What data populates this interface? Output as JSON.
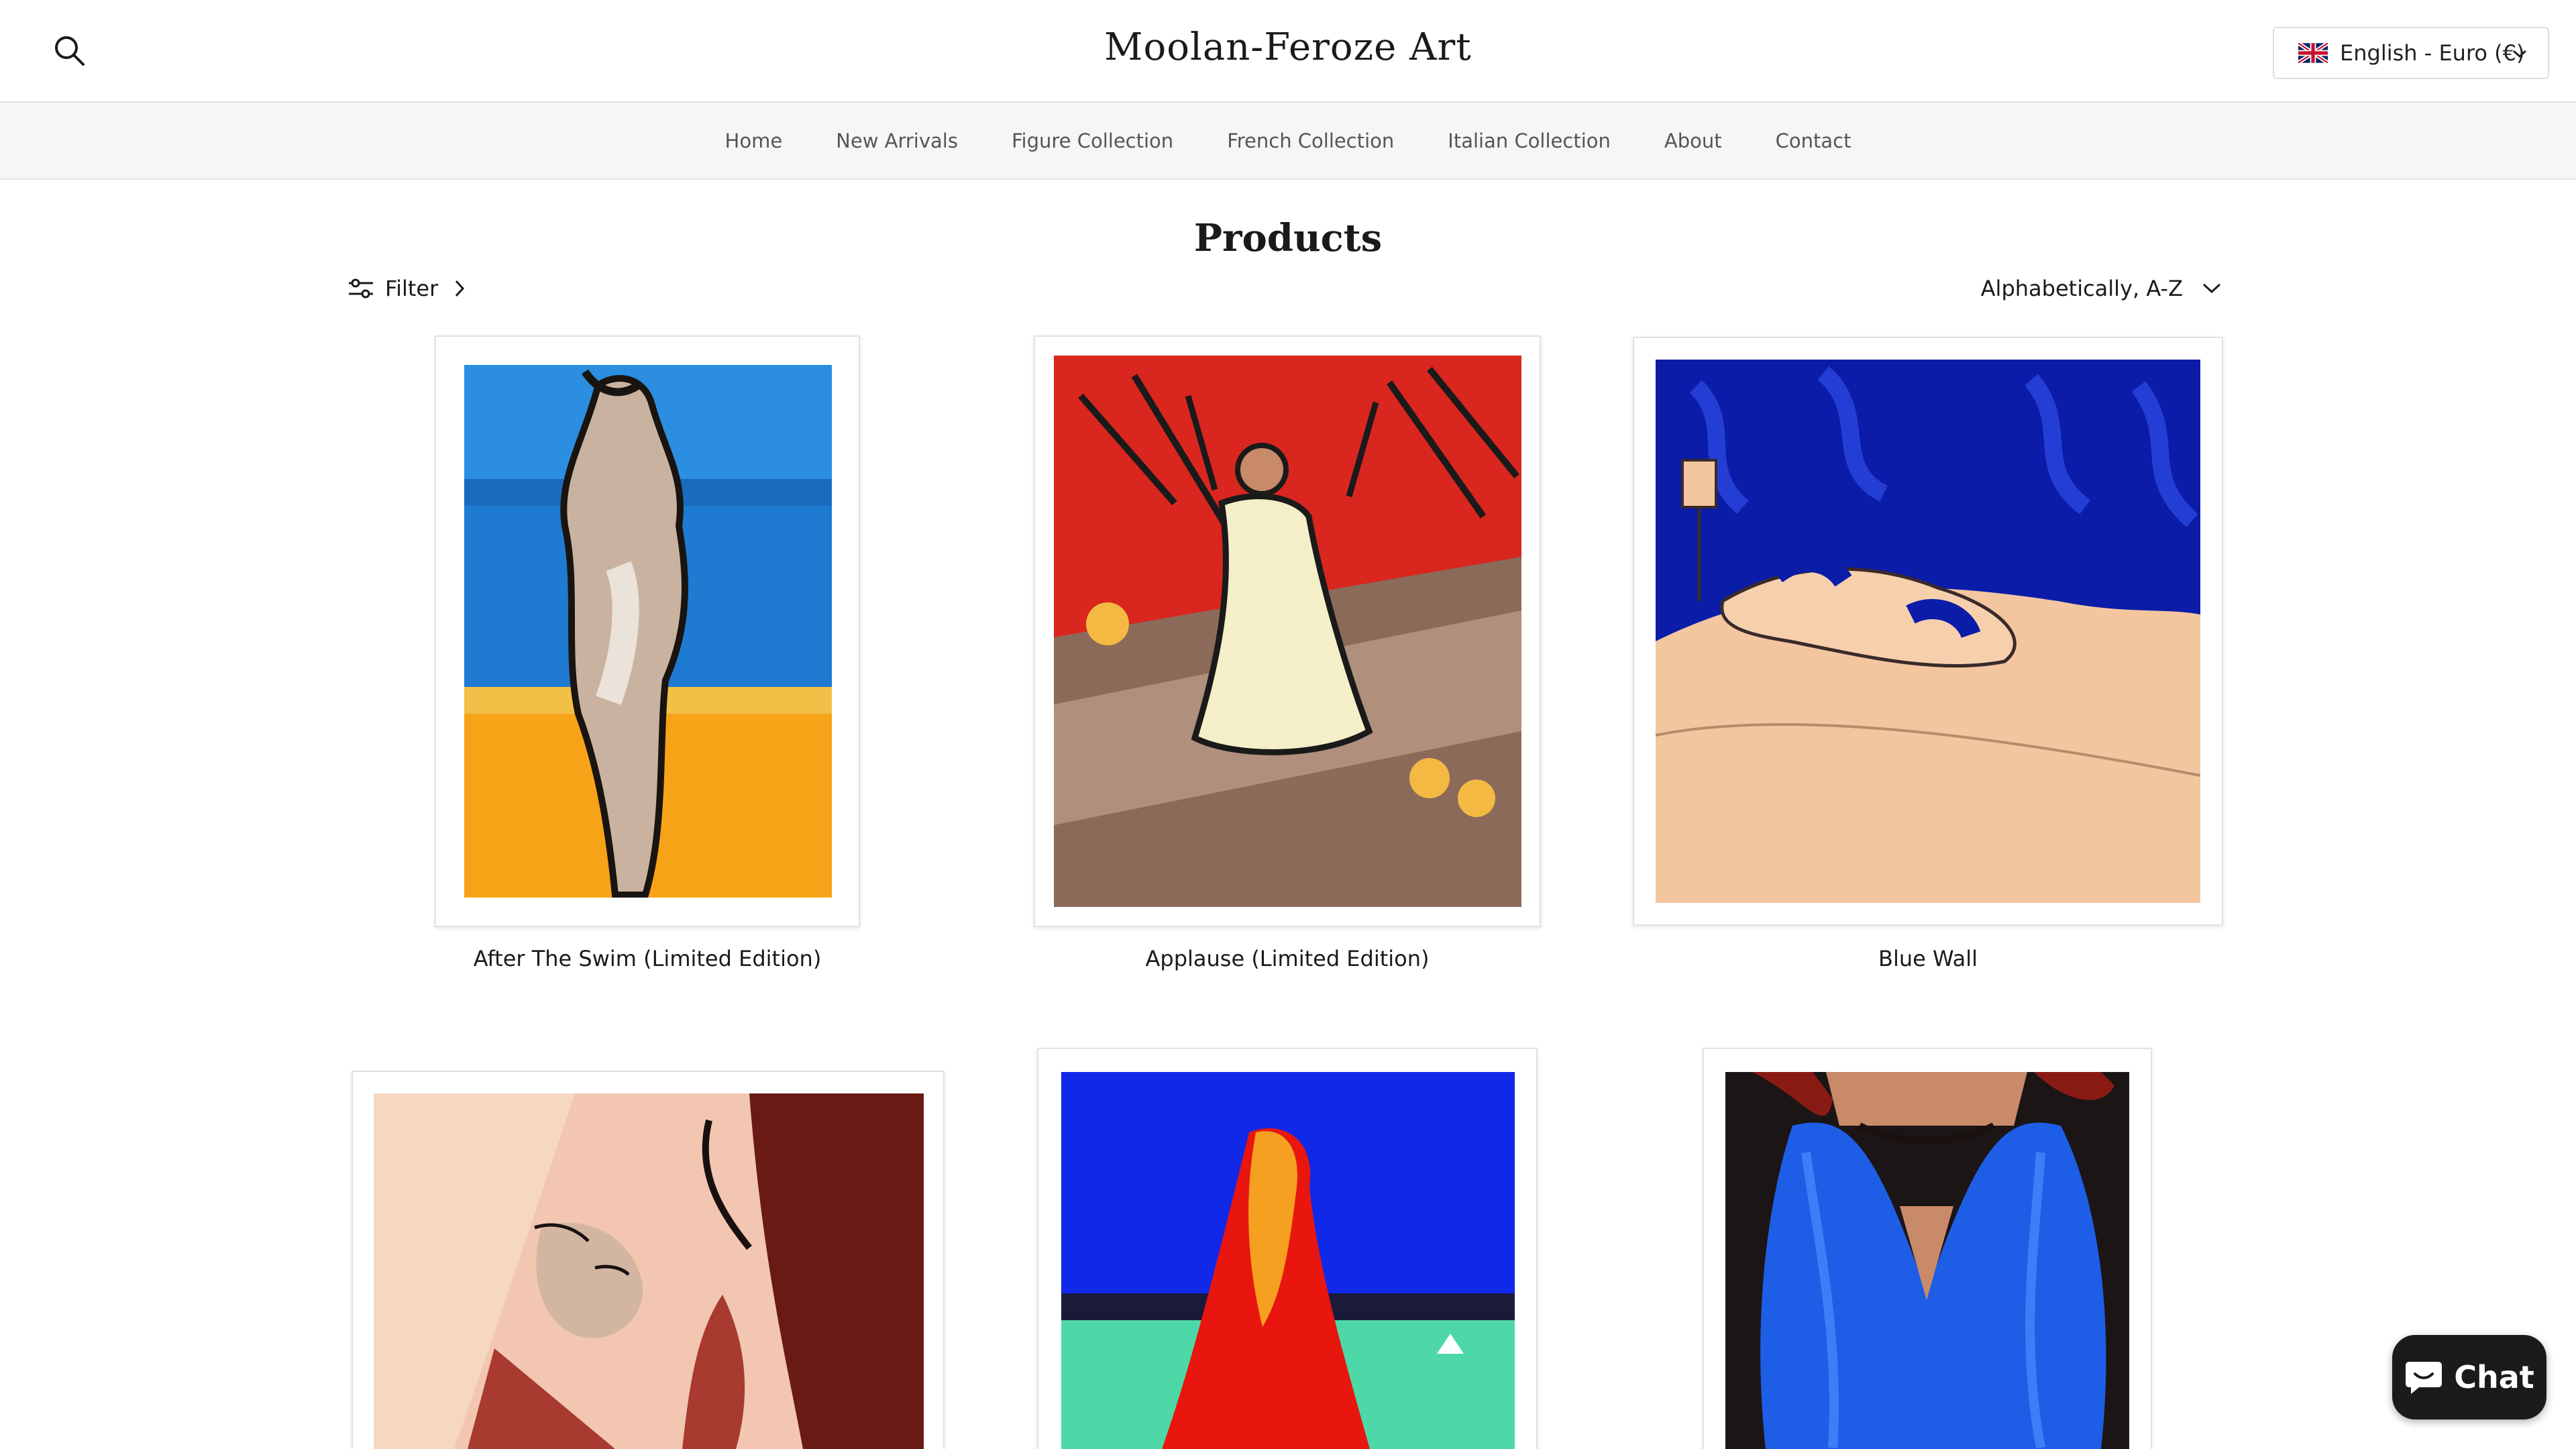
{
  "header": {
    "brand": "Moolan-Feroze Art",
    "locale": "English - Euro (€)",
    "icons": {
      "search": "search-icon",
      "flag": "uk-flag-icon",
      "locale_dropdown": "chevron-down-icon"
    }
  },
  "nav": [
    "Home",
    "New Arrivals",
    "Figure Collection",
    "French Collection",
    "Italian Collection",
    "About",
    "Contact"
  ],
  "page": {
    "title": "Products",
    "filter_label": "Filter",
    "sort_label": "Alphabetically, A-Z"
  },
  "products": [
    {
      "title": "After The Swim (Limited Edition)"
    },
    {
      "title": "Applause (Limited Edition)"
    },
    {
      "title": "Blue Wall"
    },
    {
      "title": ""
    },
    {
      "title": ""
    },
    {
      "title": ""
    }
  ],
  "chat": {
    "label": "Chat",
    "icon": "chat-bubble-icon"
  },
  "colors": {
    "nav_bg": "#f6f6f6",
    "chat_bg": "#1b1b1b",
    "border": "#e3e3e3"
  }
}
